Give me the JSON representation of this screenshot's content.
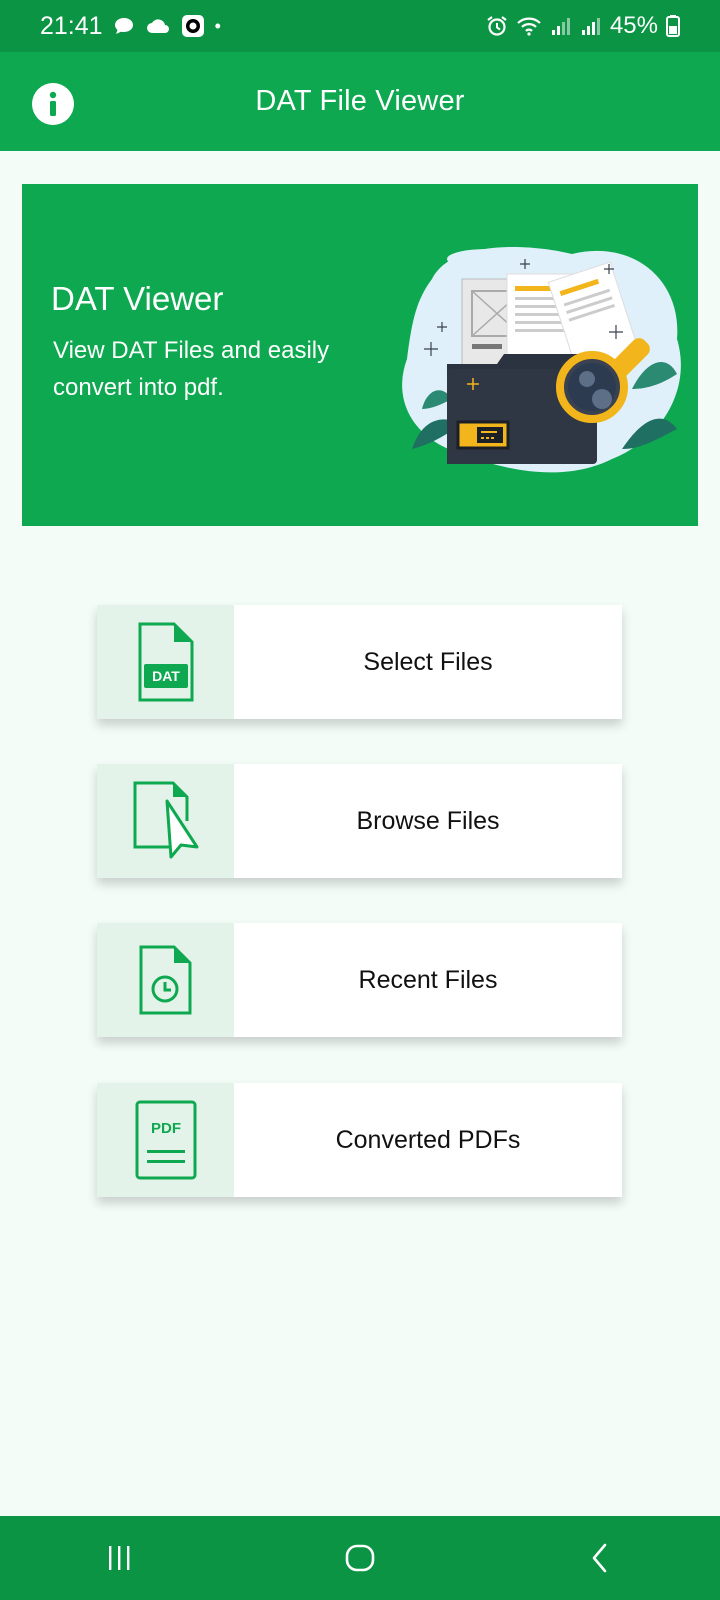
{
  "status_bar": {
    "time": "21:41",
    "battery": "45%"
  },
  "app_bar": {
    "title": "DAT File Viewer"
  },
  "banner": {
    "title": "DAT Viewer",
    "subtitle": "View DAT Files and easily convert into pdf."
  },
  "menu": [
    {
      "label": "Select Files",
      "icon": "dat-file-icon",
      "icon_text": "DAT"
    },
    {
      "label": "Browse Files",
      "icon": "file-cursor-icon"
    },
    {
      "label": "Recent Files",
      "icon": "file-clock-icon"
    },
    {
      "label": "Converted PDFs",
      "icon": "pdf-file-icon",
      "icon_text": "PDF"
    }
  ],
  "colors": {
    "primary": "#0ea850",
    "status_bar": "#0b9444",
    "background": "#f4fcf8",
    "icon_box": "#e3f3e9"
  }
}
